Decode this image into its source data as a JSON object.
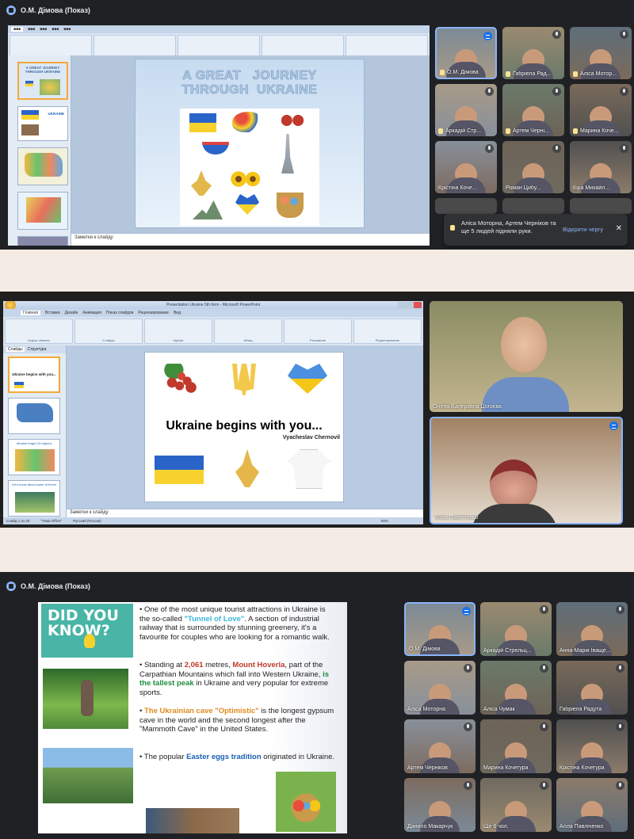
{
  "top": {
    "title": "О.М. Дімова (Показ)",
    "slide_title": "A GREAT   JOURNEY\nTHROUGH  UKRAINE",
    "notes": "Заметки к слайду",
    "thumb1": "A GREAT JOURNEY THROUGH UKRAINE",
    "thumb2": "UKRAINE",
    "participants": [
      {
        "name": "О.М. Дімова"
      },
      {
        "name": "Габріела Рад..."
      },
      {
        "name": "Аліса Мотор..."
      },
      {
        "name": "Аркадій Стр..."
      },
      {
        "name": "Артем Черні..."
      },
      {
        "name": "Марина Коче..."
      },
      {
        "name": "Крістіна Коче..."
      },
      {
        "name": "Роман Цибу..."
      },
      {
        "name": "Кіра Михайл..."
      }
    ],
    "toast": {
      "text": "Аліса Моторна, Артем Черніков та ще 5 людей підняли руки.",
      "action": "Відкрити чергу",
      "close": "✕"
    }
  },
  "middle": {
    "window_title": "Presentation Ukraine 5th form - Microsoft PowerPoint",
    "tabs": [
      "Главная",
      "Вставка",
      "Дизайн",
      "Анимация",
      "Показ слайдов",
      "Рецензирование",
      "Вид"
    ],
    "groups": [
      "Буфер обмена",
      "Слайды",
      "Шрифт",
      "Абзац",
      "Рисование",
      "Редактирование"
    ],
    "panel_tabs": [
      "Слайды",
      "Структура"
    ],
    "slide_text": "Ukraine begins with you...",
    "slide_author": "Vyacheslav Chernovil",
    "thumb1": "Ukraine begins with you...",
    "thumb3": "Ukraine forget 24 regions",
    "thumb4": "Let's know about some of them!",
    "notes": "Заметки к слайду",
    "status": [
      "Слайд 1 из 20",
      "\"Тема Office\"",
      "Русский (Россия)"
    ],
    "zoom": "60%",
    "participants": [
      {
        "name": "Олена Валеріївна Цогоєва"
      },
      {
        "name": "Алла Павліченко"
      }
    ]
  },
  "bottom": {
    "title": "О.М. Дімова (Показ)",
    "did_you_know": "DID YOU KNOW?",
    "bullets": [
      {
        "pre": "One of the most unique tourist attractions in Ukraine is the so-called ",
        "hl": "\"Tunnel of Love\"",
        "post": ". A section of industrial railway that is surrounded by stunning greenery, it's a favourite for couples who are looking for a romantic walk."
      },
      {
        "pre": "Standing at ",
        "hl": "2,061",
        "mid": " metres, ",
        "hl2": "Mount Hoverla",
        "post": ", part of the Carpathian Mountains which fall into Western Ukraine, ",
        "hl3": "is the tallest peak",
        "post2": " in Ukraine and very popular  for extreme sports."
      },
      {
        "pre": "The Ukrainian cave ",
        "hl": "\"Optimistic\"",
        "post": " is the longest gypsum cave in the world and the second longest after the \"Mammoth Cave\" in the United States."
      },
      {
        "pre": "The popular ",
        "hl": "Easter eggs tradition",
        "post": " originated in Ukraine."
      }
    ],
    "participants": [
      {
        "name": "О.М. Дімова"
      },
      {
        "name": "Аркадій Стрельц..."
      },
      {
        "name": "Анна-Марія Іваще..."
      },
      {
        "name": "Аліса Моторна"
      },
      {
        "name": "Аліса Чумак"
      },
      {
        "name": "Габріела Радута"
      },
      {
        "name": "Артем Черніков"
      },
      {
        "name": "Марина Кочегура"
      },
      {
        "name": "Крістіна Кочегура"
      },
      {
        "name": "Данило Макарчук"
      },
      {
        "name": "Ще 6 чол."
      },
      {
        "name": "Алла Павліченко"
      }
    ]
  }
}
